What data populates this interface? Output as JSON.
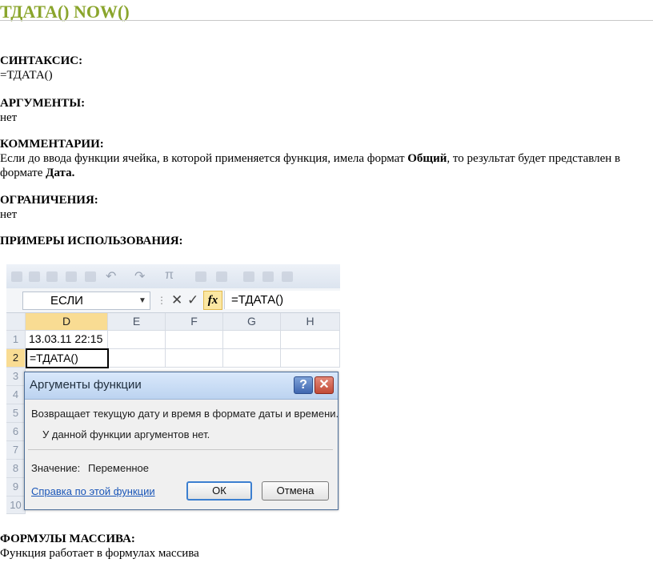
{
  "header": {
    "title": "ТДАТА() NOW()"
  },
  "syntax": {
    "heading": "СИНТАКСИС:",
    "text": "=ТДАТА()"
  },
  "arguments": {
    "heading": "АРГУМЕНТЫ:",
    "text": "нет"
  },
  "comments": {
    "heading": "КОММЕНТАРИИ:",
    "text_before": "Если до ввода функции ячейка, в которой применяется функция, имела формат ",
    "bold1": "Общий",
    "text_middle": ", то результат будет представлен в формате ",
    "bold2": "Дата."
  },
  "limits": {
    "heading": "ОГРАНИЧЕНИЯ:",
    "text": "нет"
  },
  "examples": {
    "heading": "ПРИМЕРЫ ИСПОЛЬЗОВАНИЯ:"
  },
  "excel": {
    "name_box": "ЕСЛИ",
    "formula": "=ТДАТА()",
    "fx_label": "fx",
    "cancel_sym": "✕",
    "enter_sym": "✓",
    "columns": [
      "D",
      "E",
      "F",
      "G",
      "H"
    ],
    "rows": [
      "1",
      "2",
      "3",
      "4",
      "5",
      "6",
      "7",
      "8",
      "9",
      "10"
    ],
    "cell_d1": "13.03.11 22:15",
    "cell_d2": "=ТДАТА()",
    "dialog": {
      "title": "Аргументы функции",
      "help": "?",
      "close": "✕",
      "description": "Возвращает текущую дату и время в формате даты и времени.",
      "no_args": "У данной функции аргументов нет.",
      "value_label": "Значение:",
      "value": "Переменное",
      "help_link": "Справка по этой функции",
      "ok": "ОК",
      "cancel": "Отмена"
    }
  },
  "array_formulas": {
    "heading": "ФОРМУЛЫ МАССИВА:",
    "text": "Функция работает в формулах массива"
  }
}
